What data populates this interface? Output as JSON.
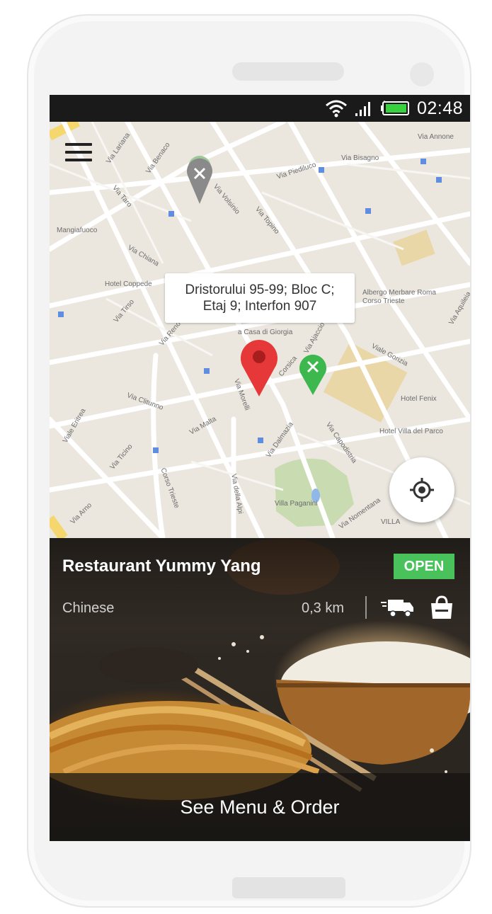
{
  "status_bar": {
    "time": "02:48",
    "icons": [
      "wifi-icon",
      "signal-icon",
      "battery-icon"
    ]
  },
  "map": {
    "street_labels": [
      "Via Annone",
      "Via Bisagno",
      "Via Piediluco",
      "Via Volsinio",
      "Via Topino",
      "Via Lariana",
      "Via Benaco",
      "Via Taro",
      "Mangiafuoco",
      "Via Chiana",
      "Hotel Coppede",
      "Via Tirso",
      "Via Reno",
      "Albergo Merbare Roma Corso Trieste",
      "Viale Gorizia",
      "Via Aquileia",
      "a Casa di Giorgia",
      "Corsica",
      "Via Ajaccio",
      "Hotel Fenix",
      "Via Clitunno",
      "Via Malta",
      "Via Dalmazia",
      "Via Capodistria",
      "Hotel Villa del Parco",
      "Via Ticino",
      "Corso Trieste",
      "Via della Alpi",
      "Villa Paganini",
      "Via Nomentana",
      "Via Arno",
      "Via Morelli",
      "Viale Eritrea",
      "VILLA"
    ],
    "address_tooltip": {
      "line1": "Dristorului 95-99; Bloc C;",
      "line2": "Etaj 9; Interfon 907"
    }
  },
  "restaurant": {
    "name": "Restaurant Yummy Yang",
    "status": "OPEN",
    "cuisine": "Chinese",
    "distance": "0,3 km",
    "service_icons": [
      "delivery-truck-icon",
      "shopping-bag-icon"
    ],
    "cta_label": "See Menu & Order"
  },
  "colors": {
    "open_badge": "#49c25c",
    "red_pin": "#e63838",
    "green_pin": "#3db84f",
    "status_bar": "#1a1a1a"
  }
}
